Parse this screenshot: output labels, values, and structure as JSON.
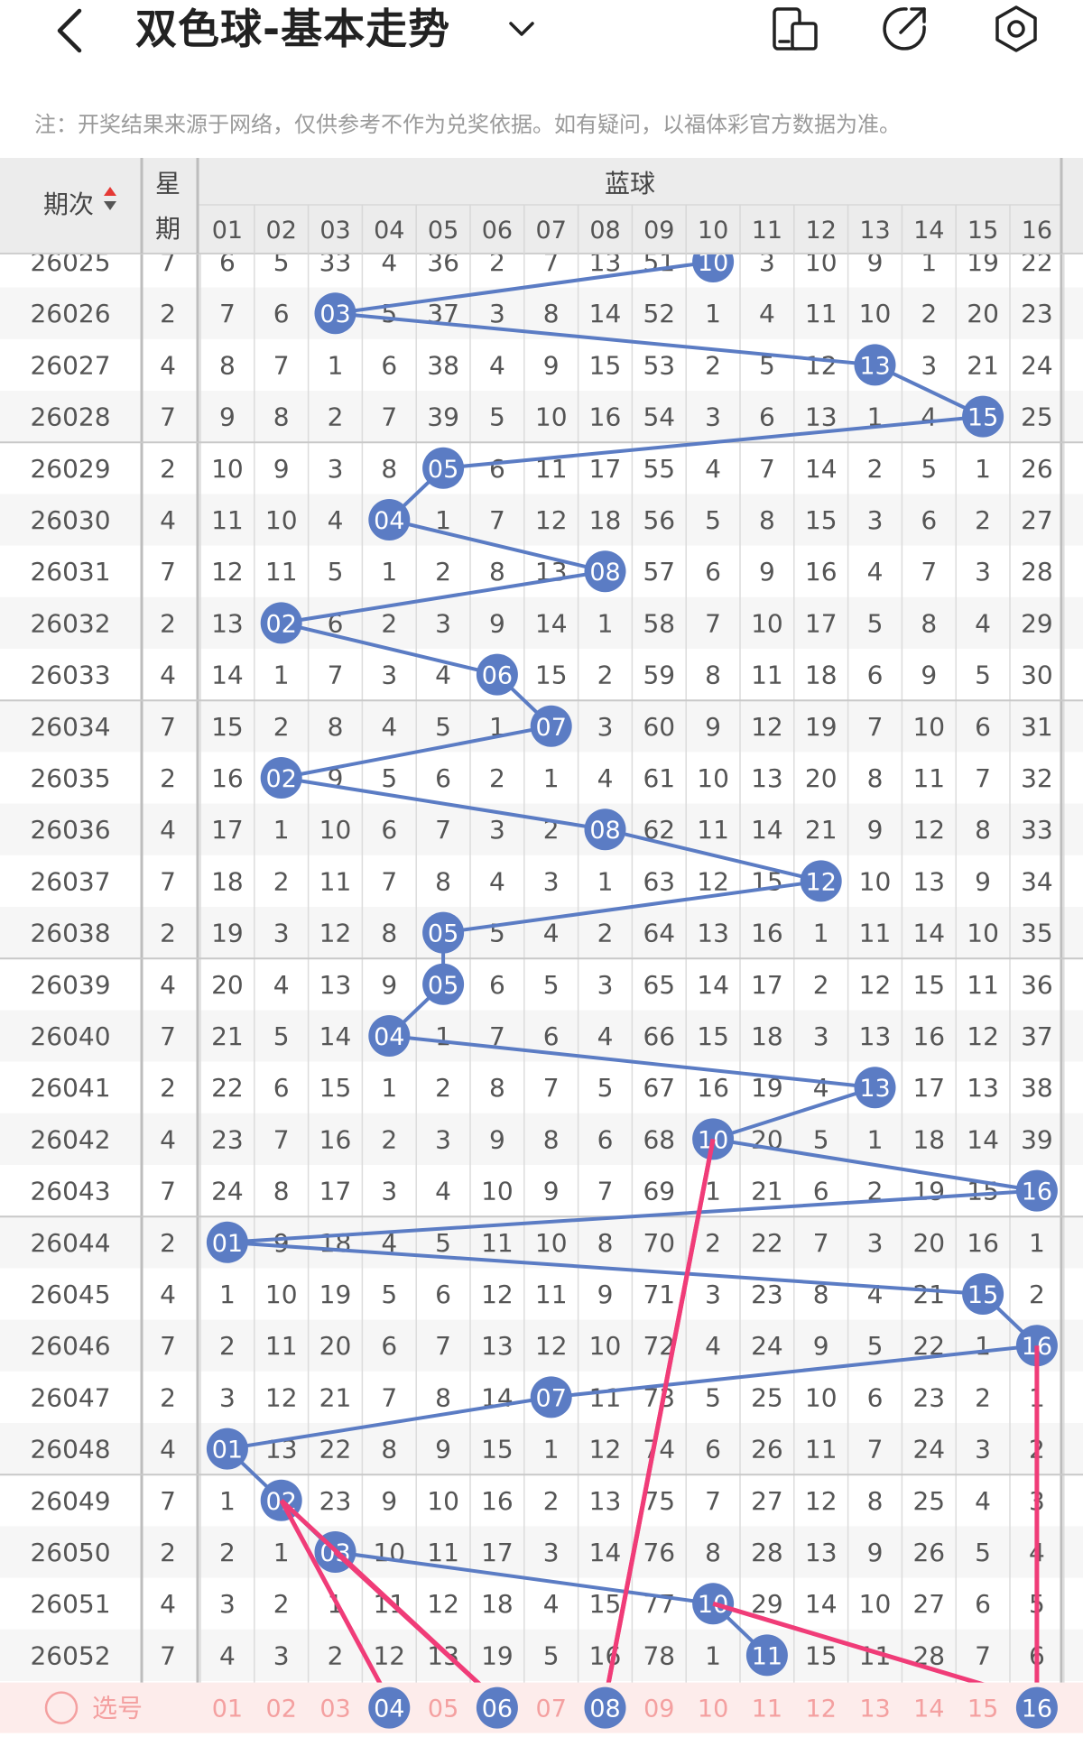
{
  "header": {
    "title": "双色球-基本走势",
    "icons": [
      "back-arrow-icon",
      "chevron-down-icon",
      "phone-layout-icon",
      "share-icon",
      "settings-icon"
    ]
  },
  "notice": "注：开奖结果来源于网络，仅供参考不作为兑奖依据。如有疑问，以福体彩官方数据为准。",
  "table": {
    "col_period": "期次",
    "col_weekday_1": "星",
    "col_weekday_2": "期",
    "group_label": "蓝球",
    "ball_headers": [
      "01",
      "02",
      "03",
      "04",
      "05",
      "06",
      "07",
      "08",
      "09",
      "10",
      "11",
      "12",
      "13",
      "14",
      "15",
      "16"
    ],
    "rows": [
      {
        "period": "26025",
        "weekday": "7",
        "cells": [
          "6",
          "5",
          "33",
          "4",
          "36",
          "2",
          "7",
          "13",
          "51",
          "10",
          "3",
          "10",
          "9",
          "1",
          "19",
          "22"
        ],
        "hit": 10
      },
      {
        "period": "26026",
        "weekday": "2",
        "cells": [
          "7",
          "6",
          "03",
          "5",
          "37",
          "3",
          "8",
          "14",
          "52",
          "1",
          "4",
          "11",
          "10",
          "2",
          "20",
          "23"
        ],
        "hit": 3
      },
      {
        "period": "26027",
        "weekday": "4",
        "cells": [
          "8",
          "7",
          "1",
          "6",
          "38",
          "4",
          "9",
          "15",
          "53",
          "2",
          "5",
          "12",
          "13",
          "3",
          "21",
          "24"
        ],
        "hit": 13
      },
      {
        "period": "26028",
        "weekday": "7",
        "cells": [
          "9",
          "8",
          "2",
          "7",
          "39",
          "5",
          "10",
          "16",
          "54",
          "3",
          "6",
          "13",
          "1",
          "4",
          "15",
          "25"
        ],
        "hit": 15
      },
      {
        "period": "26029",
        "weekday": "2",
        "cells": [
          "10",
          "9",
          "3",
          "8",
          "05",
          "6",
          "11",
          "17",
          "55",
          "4",
          "7",
          "14",
          "2",
          "5",
          "1",
          "26"
        ],
        "hit": 5
      },
      {
        "period": "26030",
        "weekday": "4",
        "cells": [
          "11",
          "10",
          "4",
          "04",
          "1",
          "7",
          "12",
          "18",
          "56",
          "5",
          "8",
          "15",
          "3",
          "6",
          "2",
          "27"
        ],
        "hit": 4
      },
      {
        "period": "26031",
        "weekday": "7",
        "cells": [
          "12",
          "11",
          "5",
          "1",
          "2",
          "8",
          "13",
          "08",
          "57",
          "6",
          "9",
          "16",
          "4",
          "7",
          "3",
          "28"
        ],
        "hit": 8
      },
      {
        "period": "26032",
        "weekday": "2",
        "cells": [
          "13",
          "02",
          "6",
          "2",
          "3",
          "9",
          "14",
          "1",
          "58",
          "7",
          "10",
          "17",
          "5",
          "8",
          "4",
          "29"
        ],
        "hit": 2
      },
      {
        "period": "26033",
        "weekday": "4",
        "cells": [
          "14",
          "1",
          "7",
          "3",
          "4",
          "06",
          "15",
          "2",
          "59",
          "8",
          "11",
          "18",
          "6",
          "9",
          "5",
          "30"
        ],
        "hit": 6
      },
      {
        "period": "26034",
        "weekday": "7",
        "cells": [
          "15",
          "2",
          "8",
          "4",
          "5",
          "1",
          "07",
          "3",
          "60",
          "9",
          "12",
          "19",
          "7",
          "10",
          "6",
          "31"
        ],
        "hit": 7
      },
      {
        "period": "26035",
        "weekday": "2",
        "cells": [
          "16",
          "02",
          "9",
          "5",
          "6",
          "2",
          "1",
          "4",
          "61",
          "10",
          "13",
          "20",
          "8",
          "11",
          "7",
          "32"
        ],
        "hit": 2
      },
      {
        "period": "26036",
        "weekday": "4",
        "cells": [
          "17",
          "1",
          "10",
          "6",
          "7",
          "3",
          "2",
          "08",
          "62",
          "11",
          "14",
          "21",
          "9",
          "12",
          "8",
          "33"
        ],
        "hit": 8
      },
      {
        "period": "26037",
        "weekday": "7",
        "cells": [
          "18",
          "2",
          "11",
          "7",
          "8",
          "4",
          "3",
          "1",
          "63",
          "12",
          "15",
          "12",
          "10",
          "13",
          "9",
          "34"
        ],
        "hit": 12
      },
      {
        "period": "26038",
        "weekday": "2",
        "cells": [
          "19",
          "3",
          "12",
          "8",
          "05",
          "5",
          "4",
          "2",
          "64",
          "13",
          "16",
          "1",
          "11",
          "14",
          "10",
          "35"
        ],
        "hit": 5
      },
      {
        "period": "26039",
        "weekday": "4",
        "cells": [
          "20",
          "4",
          "13",
          "9",
          "05",
          "6",
          "5",
          "3",
          "65",
          "14",
          "17",
          "2",
          "12",
          "15",
          "11",
          "36"
        ],
        "hit": 5
      },
      {
        "period": "26040",
        "weekday": "7",
        "cells": [
          "21",
          "5",
          "14",
          "04",
          "1",
          "7",
          "6",
          "4",
          "66",
          "15",
          "18",
          "3",
          "13",
          "16",
          "12",
          "37"
        ],
        "hit": 4
      },
      {
        "period": "26041",
        "weekday": "2",
        "cells": [
          "22",
          "6",
          "15",
          "1",
          "2",
          "8",
          "7",
          "5",
          "67",
          "16",
          "19",
          "4",
          "13",
          "17",
          "13",
          "38"
        ],
        "hit": 13
      },
      {
        "period": "26042",
        "weekday": "4",
        "cells": [
          "23",
          "7",
          "16",
          "2",
          "3",
          "9",
          "8",
          "6",
          "68",
          "10",
          "20",
          "5",
          "1",
          "18",
          "14",
          "39"
        ],
        "hit": 10
      },
      {
        "period": "26043",
        "weekday": "7",
        "cells": [
          "24",
          "8",
          "17",
          "3",
          "4",
          "10",
          "9",
          "7",
          "69",
          "1",
          "21",
          "6",
          "2",
          "19",
          "15",
          "16"
        ],
        "hit": 16
      },
      {
        "period": "26044",
        "weekday": "2",
        "cells": [
          "01",
          "9",
          "18",
          "4",
          "5",
          "11",
          "10",
          "8",
          "70",
          "2",
          "22",
          "7",
          "3",
          "20",
          "16",
          "1"
        ],
        "hit": 1
      },
      {
        "period": "26045",
        "weekday": "4",
        "cells": [
          "1",
          "10",
          "19",
          "5",
          "6",
          "12",
          "11",
          "9",
          "71",
          "3",
          "23",
          "8",
          "4",
          "21",
          "15",
          "2"
        ],
        "hit": 15
      },
      {
        "period": "26046",
        "weekday": "7",
        "cells": [
          "2",
          "11",
          "20",
          "6",
          "7",
          "13",
          "12",
          "10",
          "72",
          "4",
          "24",
          "9",
          "5",
          "22",
          "1",
          "16"
        ],
        "hit": 16
      },
      {
        "period": "26047",
        "weekday": "2",
        "cells": [
          "3",
          "12",
          "21",
          "7",
          "8",
          "14",
          "07",
          "11",
          "73",
          "5",
          "25",
          "10",
          "6",
          "23",
          "2",
          "1"
        ],
        "hit": 7
      },
      {
        "period": "26048",
        "weekday": "4",
        "cells": [
          "01",
          "13",
          "22",
          "8",
          "9",
          "15",
          "1",
          "12",
          "74",
          "6",
          "26",
          "11",
          "7",
          "24",
          "3",
          "2"
        ],
        "hit": 1
      },
      {
        "period": "26049",
        "weekday": "7",
        "cells": [
          "1",
          "02",
          "23",
          "9",
          "10",
          "16",
          "2",
          "13",
          "75",
          "7",
          "27",
          "12",
          "8",
          "25",
          "4",
          "3"
        ],
        "hit": 2
      },
      {
        "period": "26050",
        "weekday": "2",
        "cells": [
          "2",
          "1",
          "03",
          "10",
          "11",
          "17",
          "3",
          "14",
          "76",
          "8",
          "28",
          "13",
          "9",
          "26",
          "5",
          "4"
        ],
        "hit": 3
      },
      {
        "period": "26051",
        "weekday": "4",
        "cells": [
          "3",
          "2",
          "1",
          "11",
          "12",
          "18",
          "4",
          "15",
          "77",
          "10",
          "29",
          "14",
          "10",
          "27",
          "6",
          "5"
        ],
        "hit": 10
      },
      {
        "period": "26052",
        "weekday": "7",
        "cells": [
          "4",
          "3",
          "2",
          "12",
          "13",
          "19",
          "5",
          "16",
          "78",
          "1",
          "11",
          "15",
          "11",
          "28",
          "7",
          "6"
        ],
        "hit": 11
      }
    ],
    "select_label": "选号",
    "selected_balls": [
      4,
      6,
      8,
      16
    ]
  },
  "colors": {
    "ball_blue": "#5b7cc4",
    "line_blue": "#5b7cc4",
    "arrow_pink": "#f03c78",
    "select_text": "#f4a0a0",
    "select_bg": "#fdeceb",
    "header_bg": "#ececec"
  }
}
